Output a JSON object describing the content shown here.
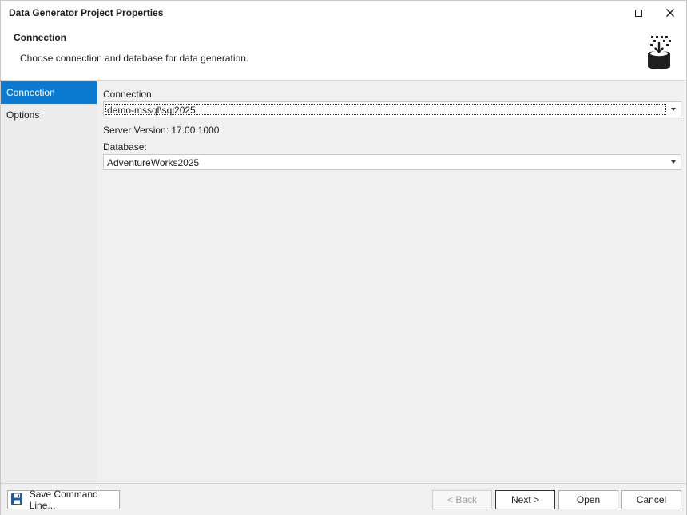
{
  "window": {
    "title": "Data Generator Project Properties"
  },
  "header": {
    "title": "Connection",
    "description": "Choose connection and database for data generation.",
    "icon": "database-import-icon"
  },
  "sidebar": {
    "items": [
      {
        "label": "Connection",
        "active": true
      },
      {
        "label": "Options",
        "active": false
      }
    ]
  },
  "form": {
    "connection_label": "Connection:",
    "connection_value": "demo-mssql\\sql2025",
    "server_version": "Server Version: 17.00.1000",
    "database_label": "Database:",
    "database_value": "AdventureWorks2025"
  },
  "footer": {
    "save_label": "Save Command Line...",
    "back_label": "< Back",
    "next_label": "Next >",
    "open_label": "Open",
    "cancel_label": "Cancel"
  },
  "colors": {
    "accent": "#0a7ad0",
    "save_icon": "#1f5ca8"
  }
}
